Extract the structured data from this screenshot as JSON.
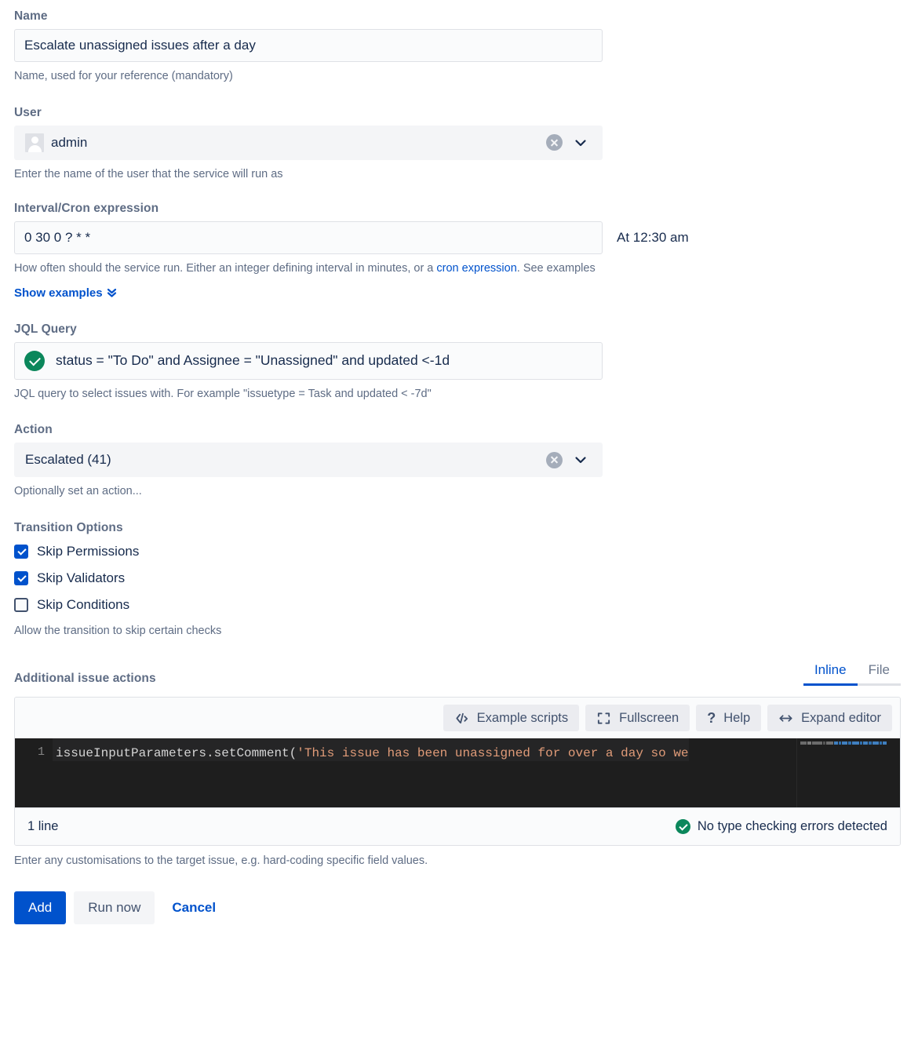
{
  "name_field": {
    "label": "Name",
    "value": "Escalate unassigned issues after a day",
    "help": "Name, used for your reference (mandatory)"
  },
  "user_field": {
    "label": "User",
    "value": "admin",
    "help": "Enter the name of the user that the service will run as",
    "clear_icon": "clear-circle-icon",
    "dropdown_icon": "chevron-down-icon",
    "avatar_icon": "user-avatar-icon"
  },
  "cron_field": {
    "label": "Interval/Cron expression",
    "value": "0 30 0 ? * *",
    "description": "At 12:30 am",
    "help_prefix": "How often should the service run. Either an integer defining interval in minutes, or a ",
    "help_link": "cron expression",
    "help_suffix": ". See examples",
    "show_examples": "Show examples",
    "show_examples_icon": "double-chevron-down-icon"
  },
  "jql_field": {
    "label": "JQL Query",
    "value": "status = \"To Do\" and Assignee = \"Unassigned\" and updated <-1d",
    "help": "JQL query to select issues with. For example \"issuetype = Task and updated < -7d\"",
    "valid_icon": "check-circle-icon"
  },
  "action_field": {
    "label": "Action",
    "value": "Escalated (41)",
    "help": "Optionally set an action...",
    "clear_icon": "clear-circle-icon",
    "dropdown_icon": "chevron-down-icon"
  },
  "transition_options": {
    "label": "Transition Options",
    "help": "Allow the transition to skip certain checks",
    "items": [
      {
        "label": "Skip Permissions",
        "checked": true
      },
      {
        "label": "Skip Validators",
        "checked": true
      },
      {
        "label": "Skip Conditions",
        "checked": false
      }
    ]
  },
  "additional_actions": {
    "label": "Additional issue actions",
    "tabs": [
      {
        "label": "Inline",
        "active": true
      },
      {
        "label": "File",
        "active": false
      }
    ],
    "toolbar": [
      {
        "label": "Example scripts",
        "icon": "code-brackets-icon"
      },
      {
        "label": "Fullscreen",
        "icon": "fullscreen-icon"
      },
      {
        "label": "Help",
        "icon": "question-mark-icon"
      },
      {
        "label": "Expand editor",
        "icon": "expand-horizontal-icon"
      }
    ],
    "editor": {
      "line_number": "1",
      "code_prefix": "issueInputParameters.setComment(",
      "code_string": "'This issue has been unassigned for over a day so we",
      "line_count": "1 line",
      "type_check_status": "No type checking errors detected",
      "type_check_icon": "check-circle-icon"
    },
    "help": "Enter any customisations to the target issue, e.g. hard-coding specific field values."
  },
  "footer": {
    "add_label": "Add",
    "run_now_label": "Run now",
    "cancel_label": "Cancel"
  },
  "colors": {
    "accent": "#0052CC",
    "label": "#5E6C84",
    "text": "#172B4D",
    "success": "#0B875B",
    "code_string": "#E09B78",
    "editor_bg": "#1E1E1E"
  }
}
